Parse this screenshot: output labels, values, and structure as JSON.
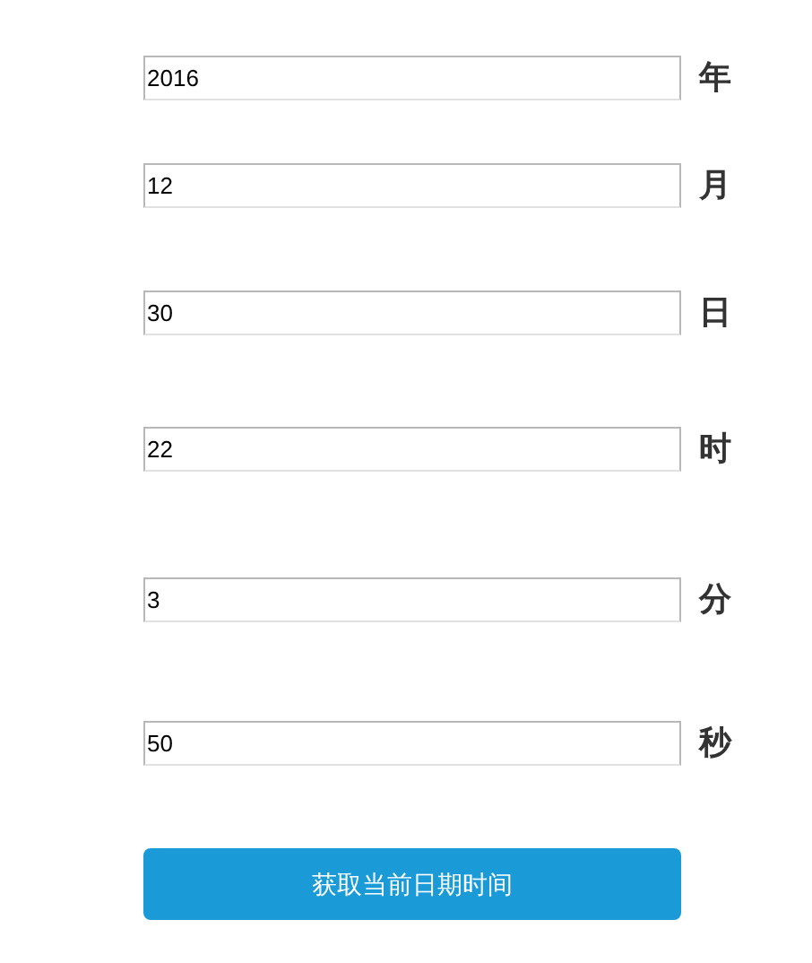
{
  "fields": [
    {
      "value": "2016",
      "unit": "年"
    },
    {
      "value": "12",
      "unit": "月"
    },
    {
      "value": "30",
      "unit": "日"
    },
    {
      "value": "22",
      "unit": "时"
    },
    {
      "value": "3",
      "unit": "分"
    },
    {
      "value": "50",
      "unit": "秒"
    }
  ],
  "button": {
    "label": "获取当前日期时间"
  }
}
